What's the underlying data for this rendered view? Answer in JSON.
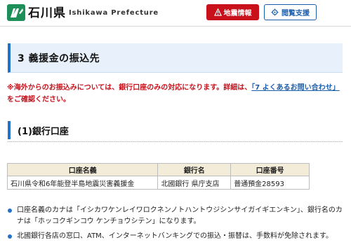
{
  "header": {
    "pref_name": "石川県",
    "pref_en": "Ishikawa Prefecture",
    "quake_label": "地震情報",
    "view_label": "閲覧支援"
  },
  "section": {
    "title": "3 義援金の振込先"
  },
  "notice": {
    "text_before": "※海外からのお振込みについては、銀行口座のみの対応になります。詳細は、",
    "link": "「7 よくあるお問い合わせ」",
    "text_after": "をご確認ください。"
  },
  "subsection": {
    "title": "(1)銀行口座"
  },
  "table": {
    "headers": [
      "口座名義",
      "銀行名",
      "口座番号"
    ],
    "rows": [
      [
        "石川県令和6年能登半島地震災害義援金",
        "北國銀行 県庁支店",
        "普通預金28593"
      ]
    ]
  },
  "bullets": [
    "口座名義のカナは「イシカワケンレイワロクネンノトハントウジシンサイガイギエンキン」、銀行名のカナは「ホッコクギンコウ ケンチョウシテン」になります。",
    "北國銀行各店の窓口、ATM、インターネットバンキングでの振込・振替は、手数料が免除されます。"
  ],
  "colors": {
    "accent_blue": "#2471c8",
    "alert_red": "#c8111b",
    "table_header_bg": "#f3ecd8",
    "section_bg": "#e8f1fb"
  },
  "icons": {
    "logo": "ishikawa-logo-icon",
    "quake": "warning-icon",
    "view": "gear-icon"
  }
}
